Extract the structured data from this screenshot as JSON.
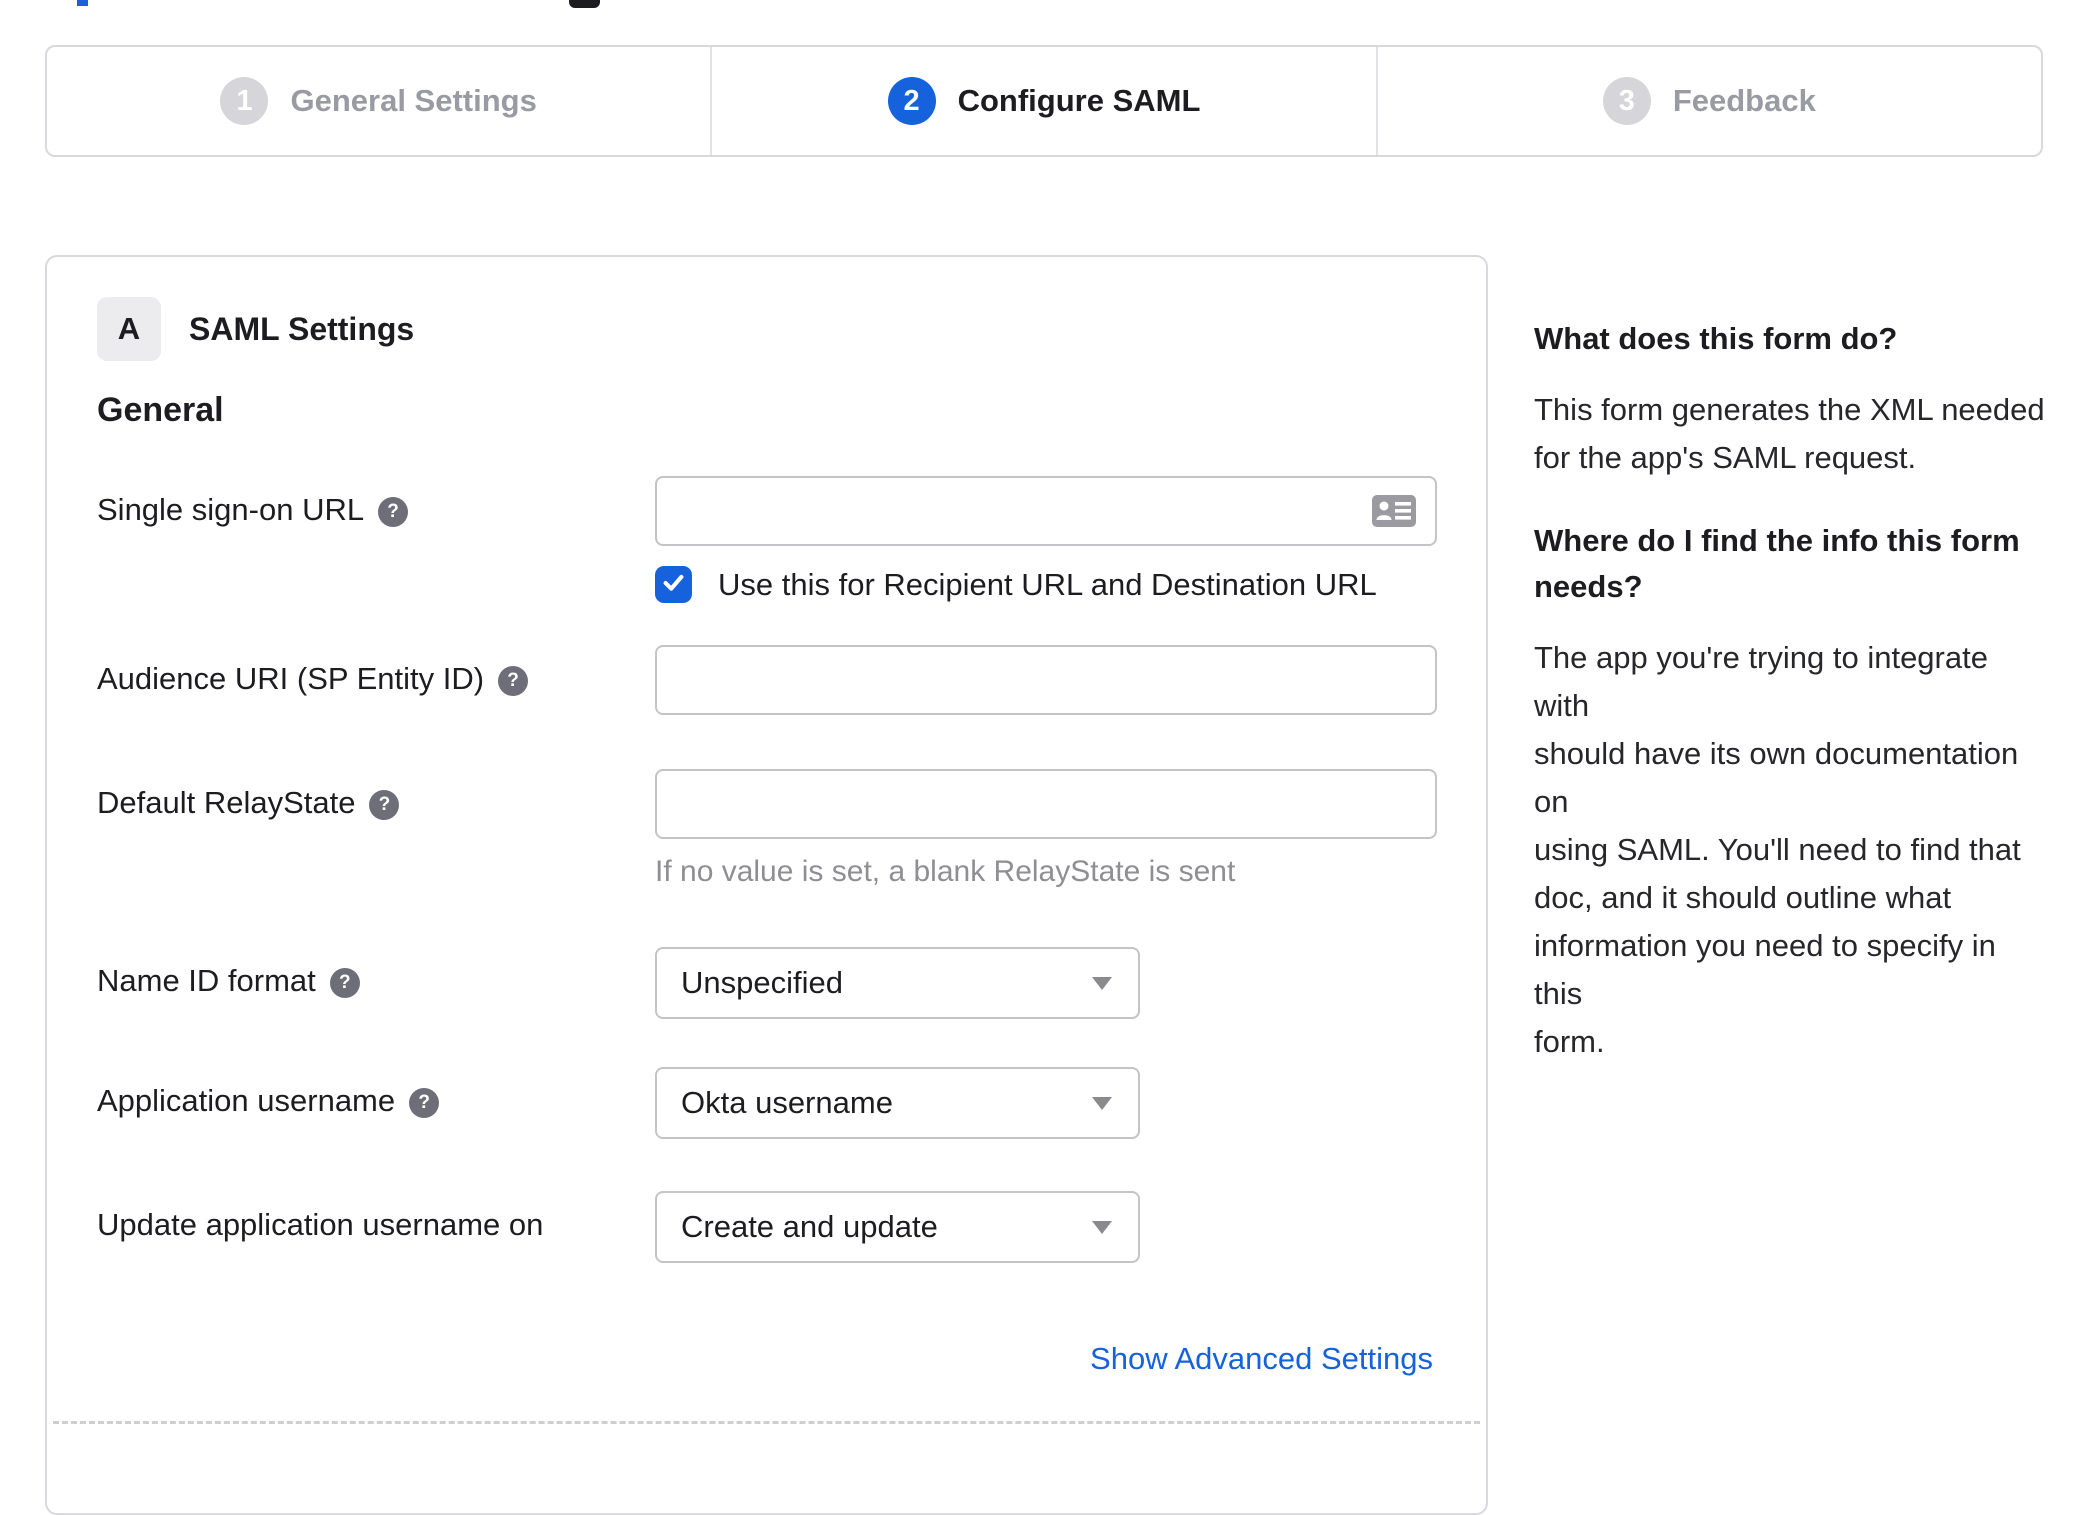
{
  "stepper": {
    "steps": [
      {
        "number": "1",
        "label": "General Settings",
        "state": "inactive"
      },
      {
        "number": "2",
        "label": "Configure SAML",
        "state": "active"
      },
      {
        "number": "3",
        "label": "Feedback",
        "state": "inactive"
      }
    ]
  },
  "panel": {
    "badge": "A",
    "title": "SAML Settings",
    "section": "General",
    "help_glyph": "?",
    "sso": {
      "label": "Single sign-on URL",
      "value": "",
      "checkbox_label": "Use this for Recipient URL and Destination URL",
      "checked": true
    },
    "audience": {
      "label": "Audience URI (SP Entity ID)",
      "value": ""
    },
    "relay": {
      "label": "Default RelayState",
      "value": "",
      "hint": "If no value is set, a blank RelayState is sent"
    },
    "name_id": {
      "label": "Name ID format",
      "value": "Unspecified"
    },
    "app_username": {
      "label": "Application username",
      "value": "Okta username"
    },
    "update_username": {
      "label": "Update application username on",
      "value": "Create and update"
    },
    "advanced_link": "Show Advanced Settings"
  },
  "sidebar": {
    "heading1": "What does this form do?",
    "para1": "This form generates the XML needed\nfor the app's SAML request.",
    "heading2": "Where do I find the info this form\nneeds?",
    "para2": "The app you're trying to integrate with\nshould have its own documentation on\nusing SAML. You'll need to find that\ndoc, and it should outline what\ninformation you need to specify in this\nform."
  },
  "colors": {
    "accent_blue": "#1662dd",
    "inactive_gray": "#9a9aa2",
    "text_dark": "#1d1d21",
    "hint_gray": "#8e8e93",
    "border_gray": "#c3c3c8"
  }
}
